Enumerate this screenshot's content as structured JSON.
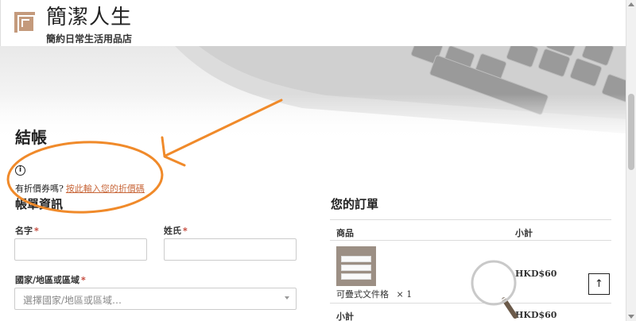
{
  "site": {
    "title": "簡潔人生",
    "tagline": "簡約日常生活用品店"
  },
  "page": {
    "title": "結帳"
  },
  "coupon": {
    "info_icon": "info-circle-icon",
    "prompt": "有折價券嗎?",
    "link": "按此輸入您的折價碼"
  },
  "billing": {
    "heading": "帳單資訊",
    "first_name_label": "名字",
    "last_name_label": "姓氏",
    "country_label": "國家/地區或區域",
    "required_mark": "*",
    "country_placeholder": "選擇國家/地區或區域…"
  },
  "order": {
    "heading": "您的訂單",
    "col_product": "商品",
    "col_subtotal": "小計",
    "items": [
      {
        "name": "可疊式文件格",
        "qty": "× 1",
        "price": "HKD$60"
      }
    ],
    "subtotal_label": "小計",
    "subtotal_value": "HKD$60"
  },
  "scroll_top": {
    "icon": "arrow-up-icon",
    "glyph": "↑"
  },
  "colors": {
    "accent": "#c8673a",
    "logo": "#c49a7c",
    "annotation": "#f08a2a",
    "required": "#c0392b"
  }
}
